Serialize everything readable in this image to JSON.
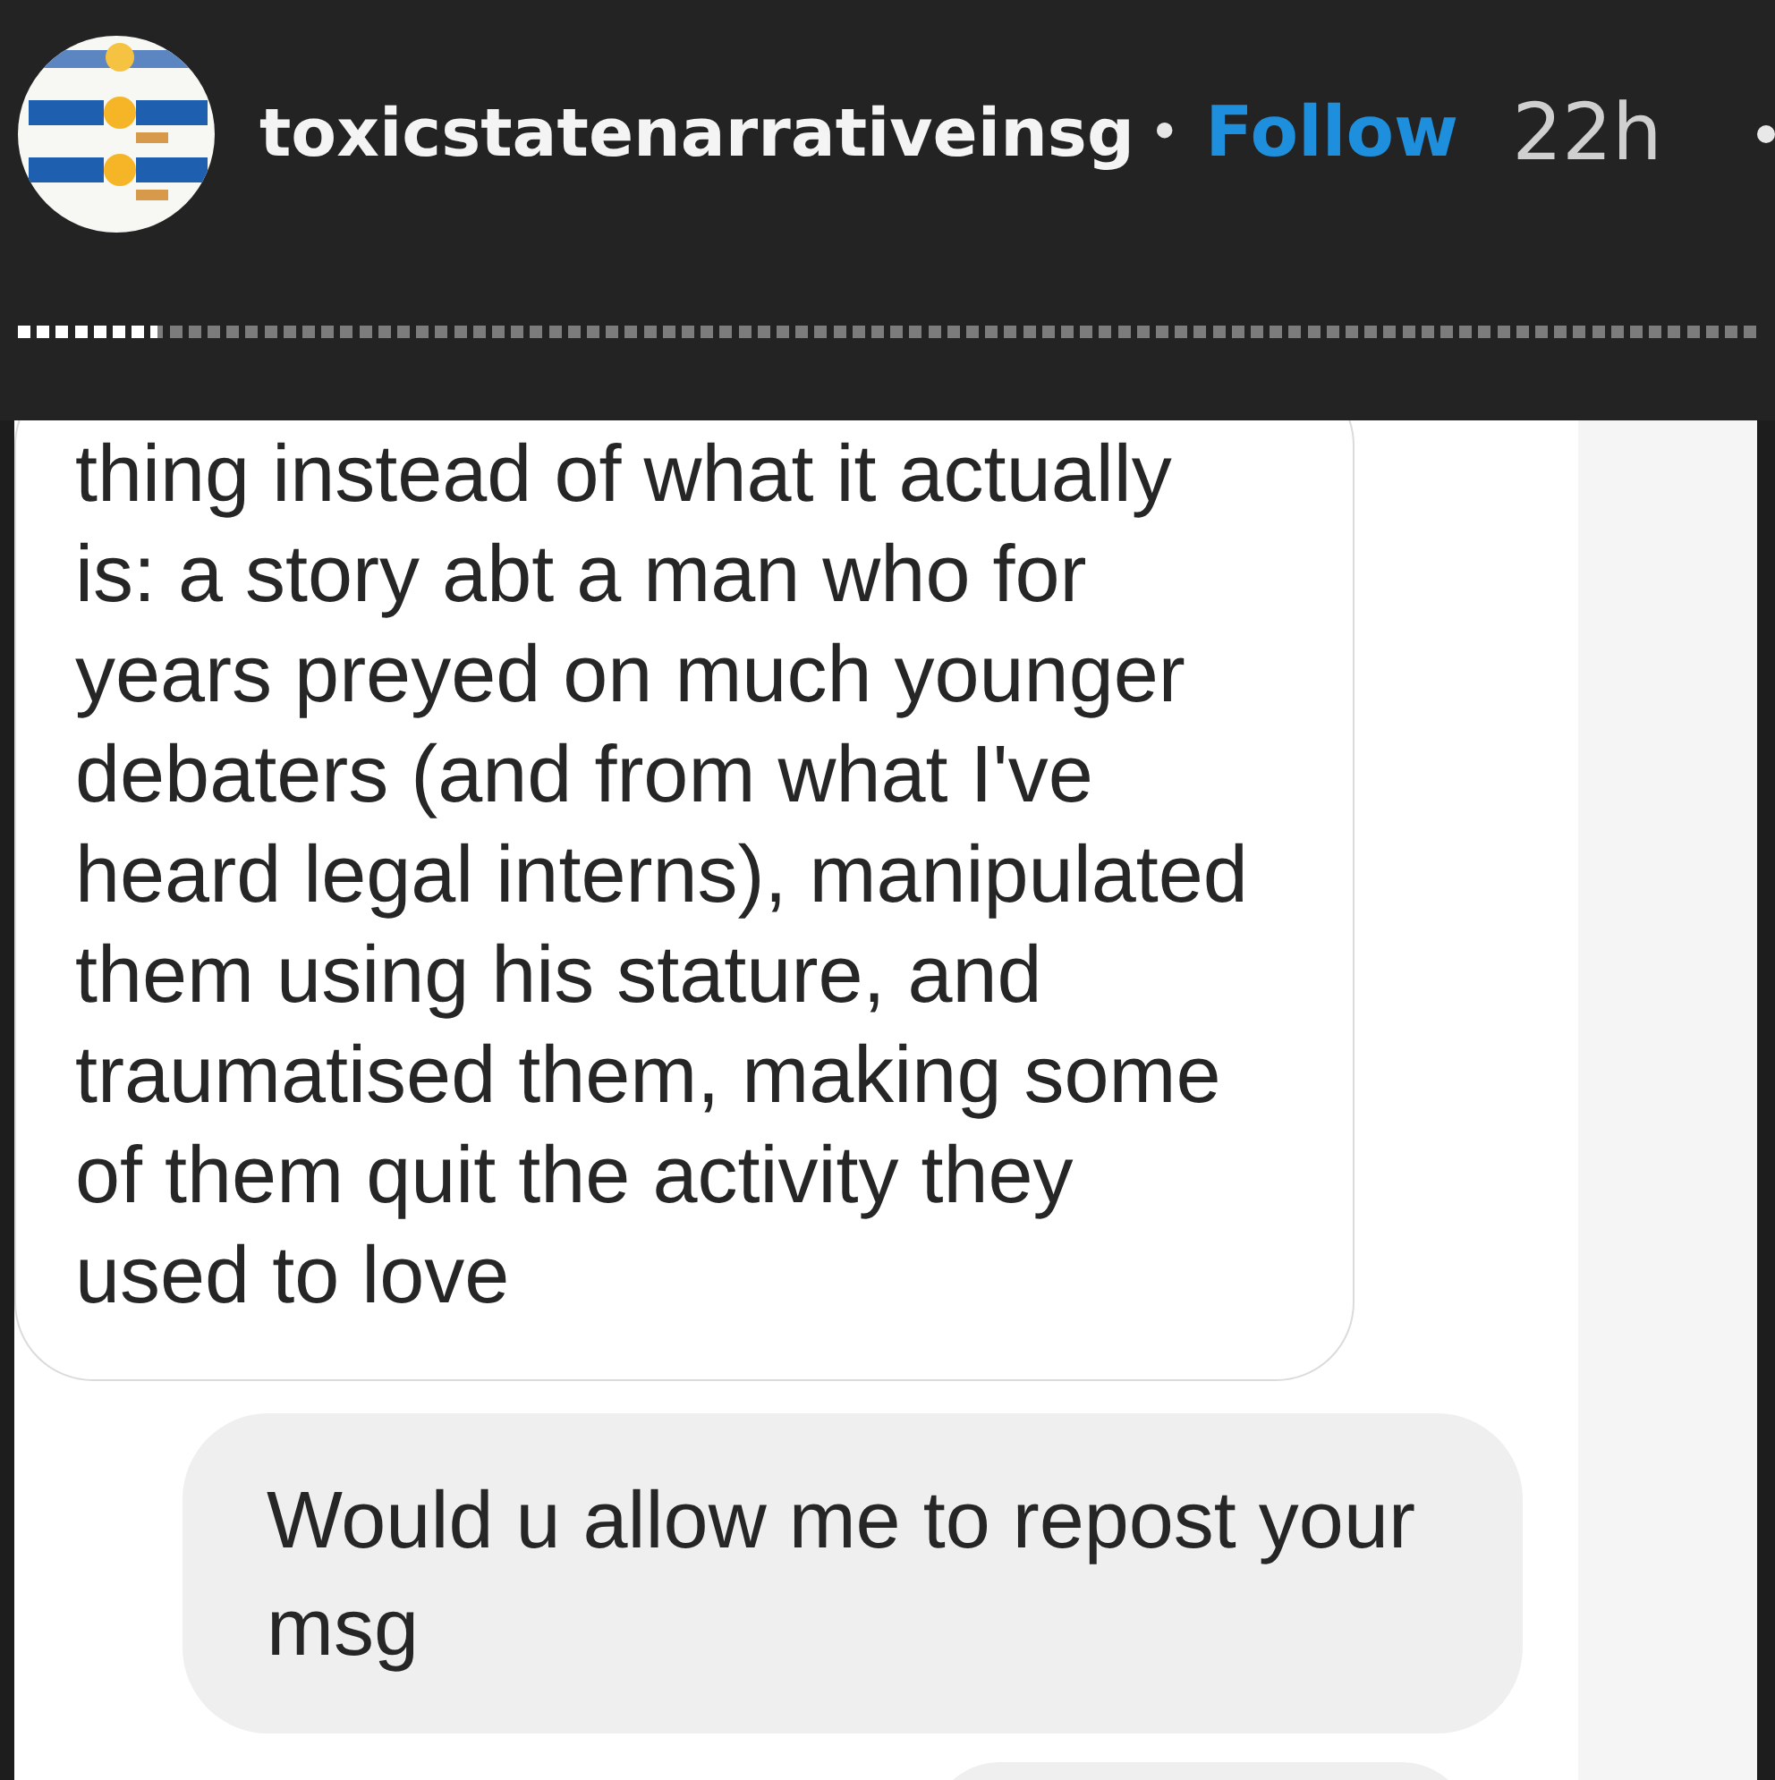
{
  "header": {
    "username": "toxicstatenarrativeinsg",
    "separator": "•",
    "follow": "Follow",
    "time": "22h"
  },
  "story_progress": {
    "level": 0.08
  },
  "messages": [
    {
      "kind": "received",
      "text": "thing instead of what it actually is: a story abt a man who for years preyed on much younger debaters (and from what I've heard legal interns), manipulated them using his stature, and traumatised them, making some of them quit the activity they used to love"
    },
    {
      "kind": "sent",
      "text": "Would u allow me to repost your msg"
    },
    {
      "kind": "sent"
    }
  ]
}
